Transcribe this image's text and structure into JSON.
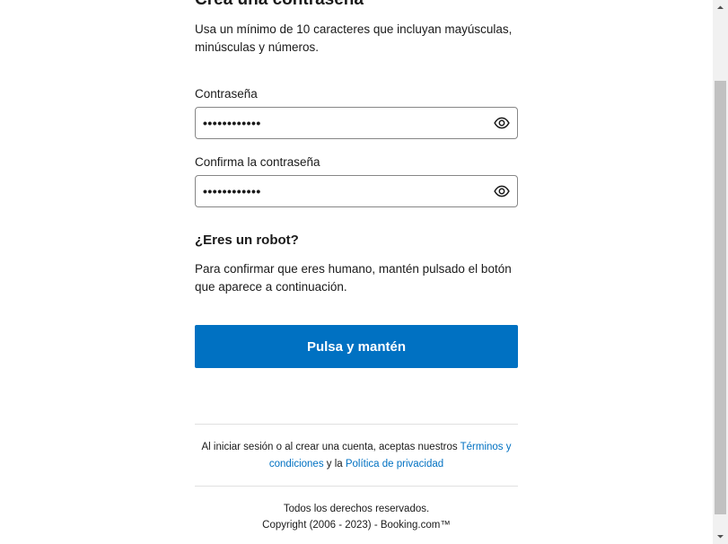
{
  "header": {
    "title": "Crea una contraseña",
    "subtitle": "Usa un mínimo de 10 caracteres que incluyan mayúsculas, minúsculas y números."
  },
  "password": {
    "label": "Contraseña",
    "value": "••••••••••••"
  },
  "confirm": {
    "label": "Confirma la contraseña",
    "value": "••••••••••••"
  },
  "robot": {
    "title": "¿Eres un robot?",
    "description": "Para confirmar que eres humano, mantén pulsado el botón que aparece a continuación.",
    "button_label": "Pulsa y mantén"
  },
  "legal": {
    "prefix": "Al iniciar sesión o al crear una cuenta, aceptas nuestros ",
    "terms_link": "Términos y condiciones",
    "middle": " y la ",
    "privacy_link": "Política de privacidad"
  },
  "footer": {
    "line1": "Todos los derechos reservados.",
    "line2": "Copyright (2006 - 2023) - Booking.com™"
  },
  "colors": {
    "primary": "#0071c2",
    "link": "#0071c2",
    "field_border": "#868686"
  },
  "icons": {
    "password_toggle": "eye-icon",
    "confirm_toggle": "eye-icon"
  }
}
